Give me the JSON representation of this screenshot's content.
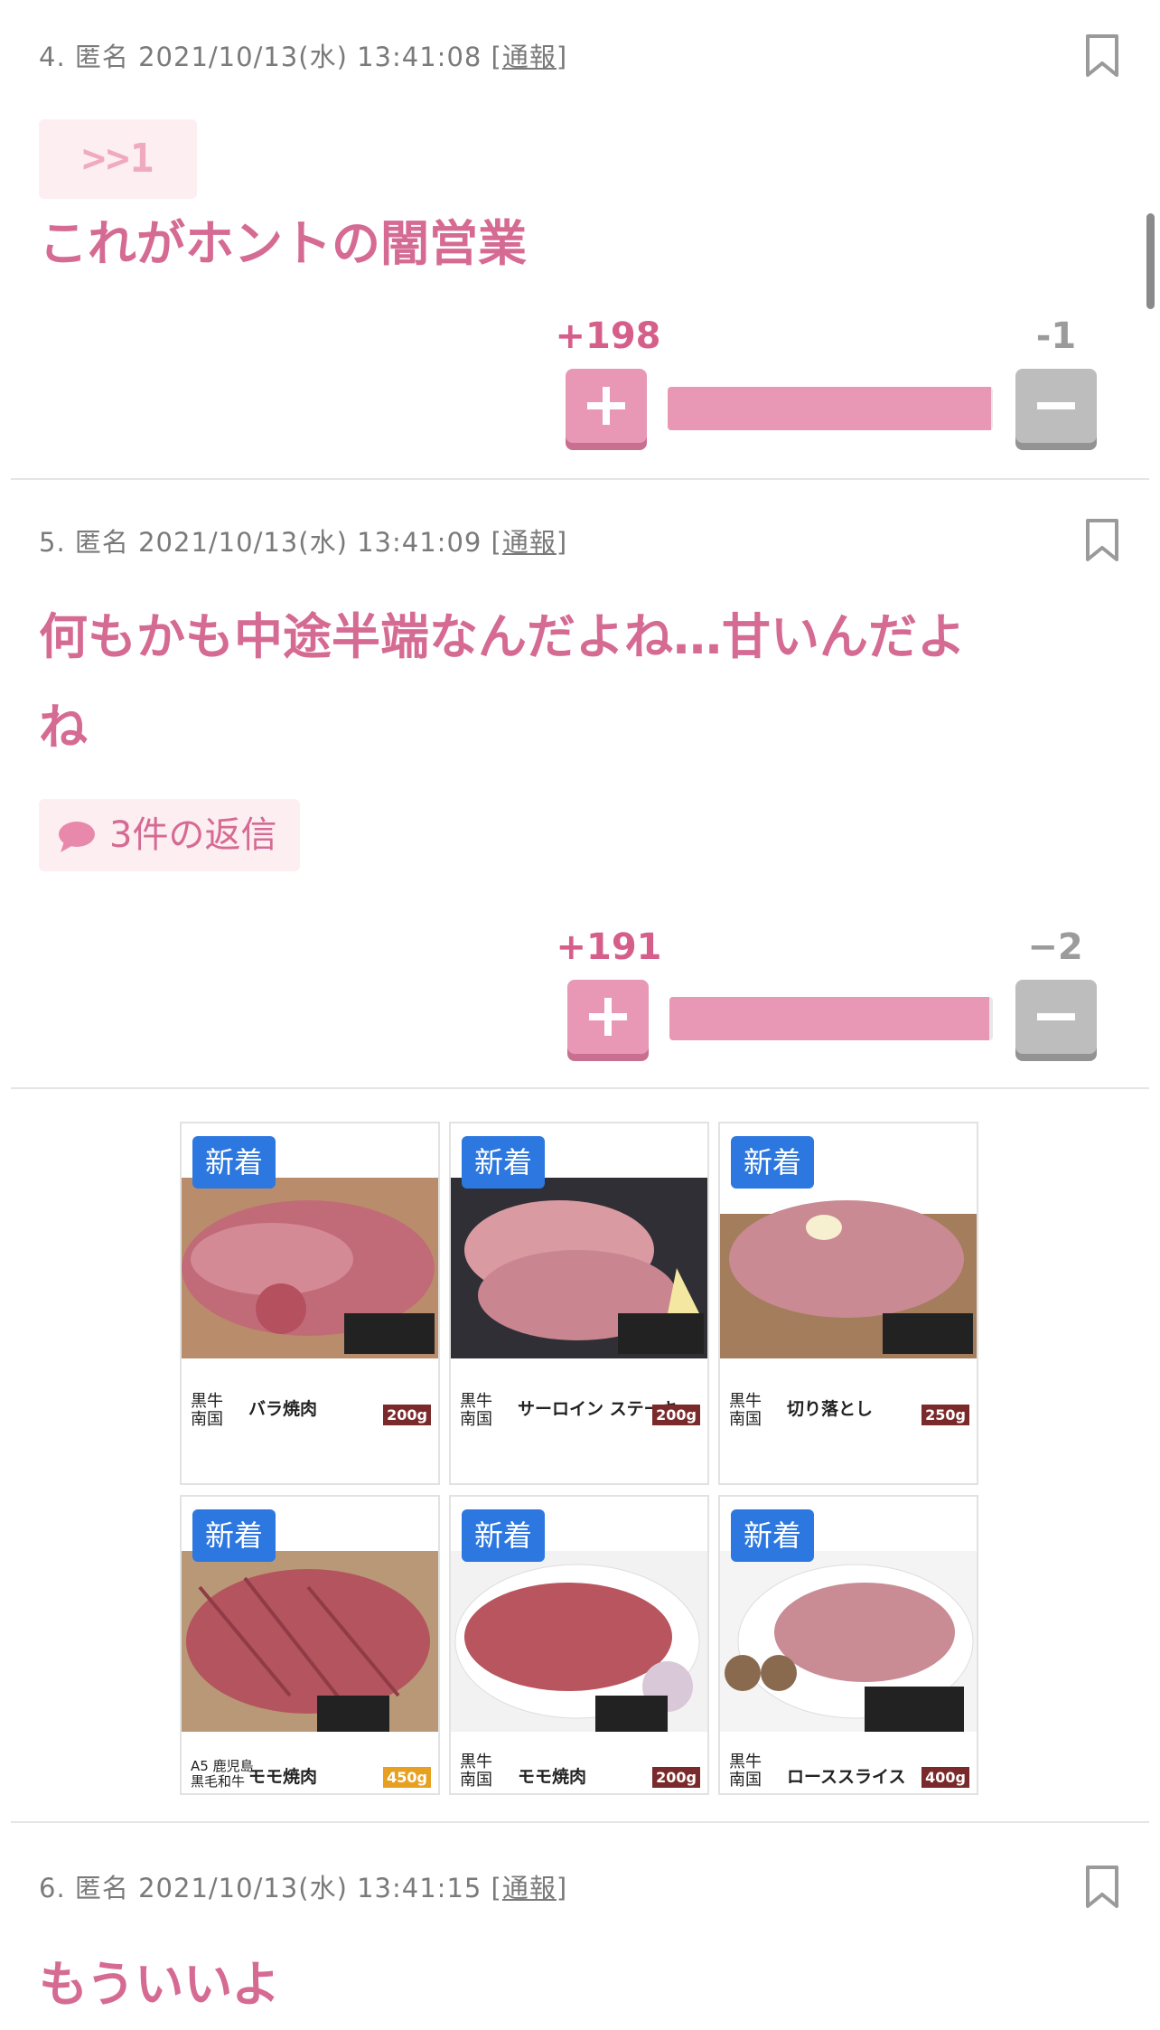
{
  "comments": [
    {
      "meta_prefix": "4. 匿名 2021/10/13(水) 13:41:08 [",
      "report_label": "通報",
      "meta_suffix": "]",
      "anchor": ">>1",
      "body_lines": [
        "これがホントの闇営業"
      ],
      "plus_label": "+198",
      "minus_label": "-1",
      "plus_fraction": 0.995
    },
    {
      "meta_prefix": "5. 匿名 2021/10/13(水) 13:41:09 [",
      "report_label": "通報",
      "meta_suffix": "]",
      "body_lines": [
        "何もかも中途半端なんだよね…甘いんだよ",
        "ね"
      ],
      "reply_label": "3件の返信",
      "plus_label": "+191",
      "minus_label": "−2",
      "plus_fraction": 0.99
    },
    {
      "meta_prefix": "6. 匿名 2021/10/13(水) 13:41:15 [",
      "report_label": "通報",
      "meta_suffix": "]",
      "body_lines": [
        "もういいよ"
      ]
    }
  ],
  "ad": {
    "badge_label": "新着",
    "items": [
      {
        "brand": "黒牛 南国",
        "name": "バラ焼肉",
        "weight": "200g"
      },
      {
        "brand": "黒牛 南国",
        "name": "サーロイン ステーキ",
        "weight": "200g"
      },
      {
        "brand": "黒牛 南国",
        "name": "切り落とし",
        "weight": "250g"
      },
      {
        "brand": "A5 鹿児島 黒毛和牛",
        "name": "モモ焼肉",
        "weight": "450g"
      },
      {
        "brand": "黒牛 南国",
        "name": "モモ焼肉",
        "weight": "200g"
      },
      {
        "brand": "黒牛 南国",
        "name": "ローススライス",
        "weight": "400g"
      }
    ]
  },
  "colors": {
    "accent": "#d56a93",
    "plus_button": "#e898b5",
    "minus_button": "#bdbdbd",
    "badge": "#2d78e0"
  },
  "icons": [
    "bookmark-icon",
    "speech-bubble-icon",
    "plus-icon",
    "minus-icon",
    "info-icon",
    "close-icon"
  ]
}
